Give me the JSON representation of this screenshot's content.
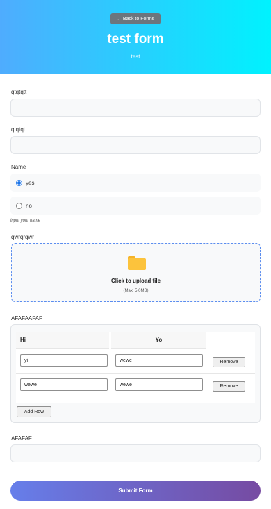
{
  "header": {
    "back_label": "← Back to Forms",
    "title": "test form",
    "subtitle": "test",
    "gradient_start": "#4facfe",
    "gradient_end": "#00f2fe"
  },
  "fields": {
    "field1": {
      "label": "qtqtqtt",
      "value": ""
    },
    "field2": {
      "label": "qtqtqt",
      "value": ""
    },
    "name": {
      "label": "Name",
      "options": [
        {
          "label": "yes",
          "checked": true
        },
        {
          "label": "no",
          "checked": false
        }
      ],
      "help_text": "input your name"
    },
    "upload": {
      "label": "qwrqrqwr",
      "icon": "folder-icon",
      "title": "Click to upload file",
      "subtitle": "(Max: 5.0MB)"
    },
    "table": {
      "label": "AFAFAAFAF",
      "columns": [
        "Hi",
        "Yo"
      ],
      "rows": [
        [
          "yi",
          "wewe"
        ],
        [
          "wewe",
          "wewe"
        ]
      ],
      "remove_label": "Remove",
      "add_row_label": "Add Row"
    },
    "field3": {
      "label": "AFAFAF",
      "value": ""
    }
  },
  "submit": {
    "label": "Submit Form",
    "gradient_start": "#667eea",
    "gradient_end": "#764ba2"
  }
}
